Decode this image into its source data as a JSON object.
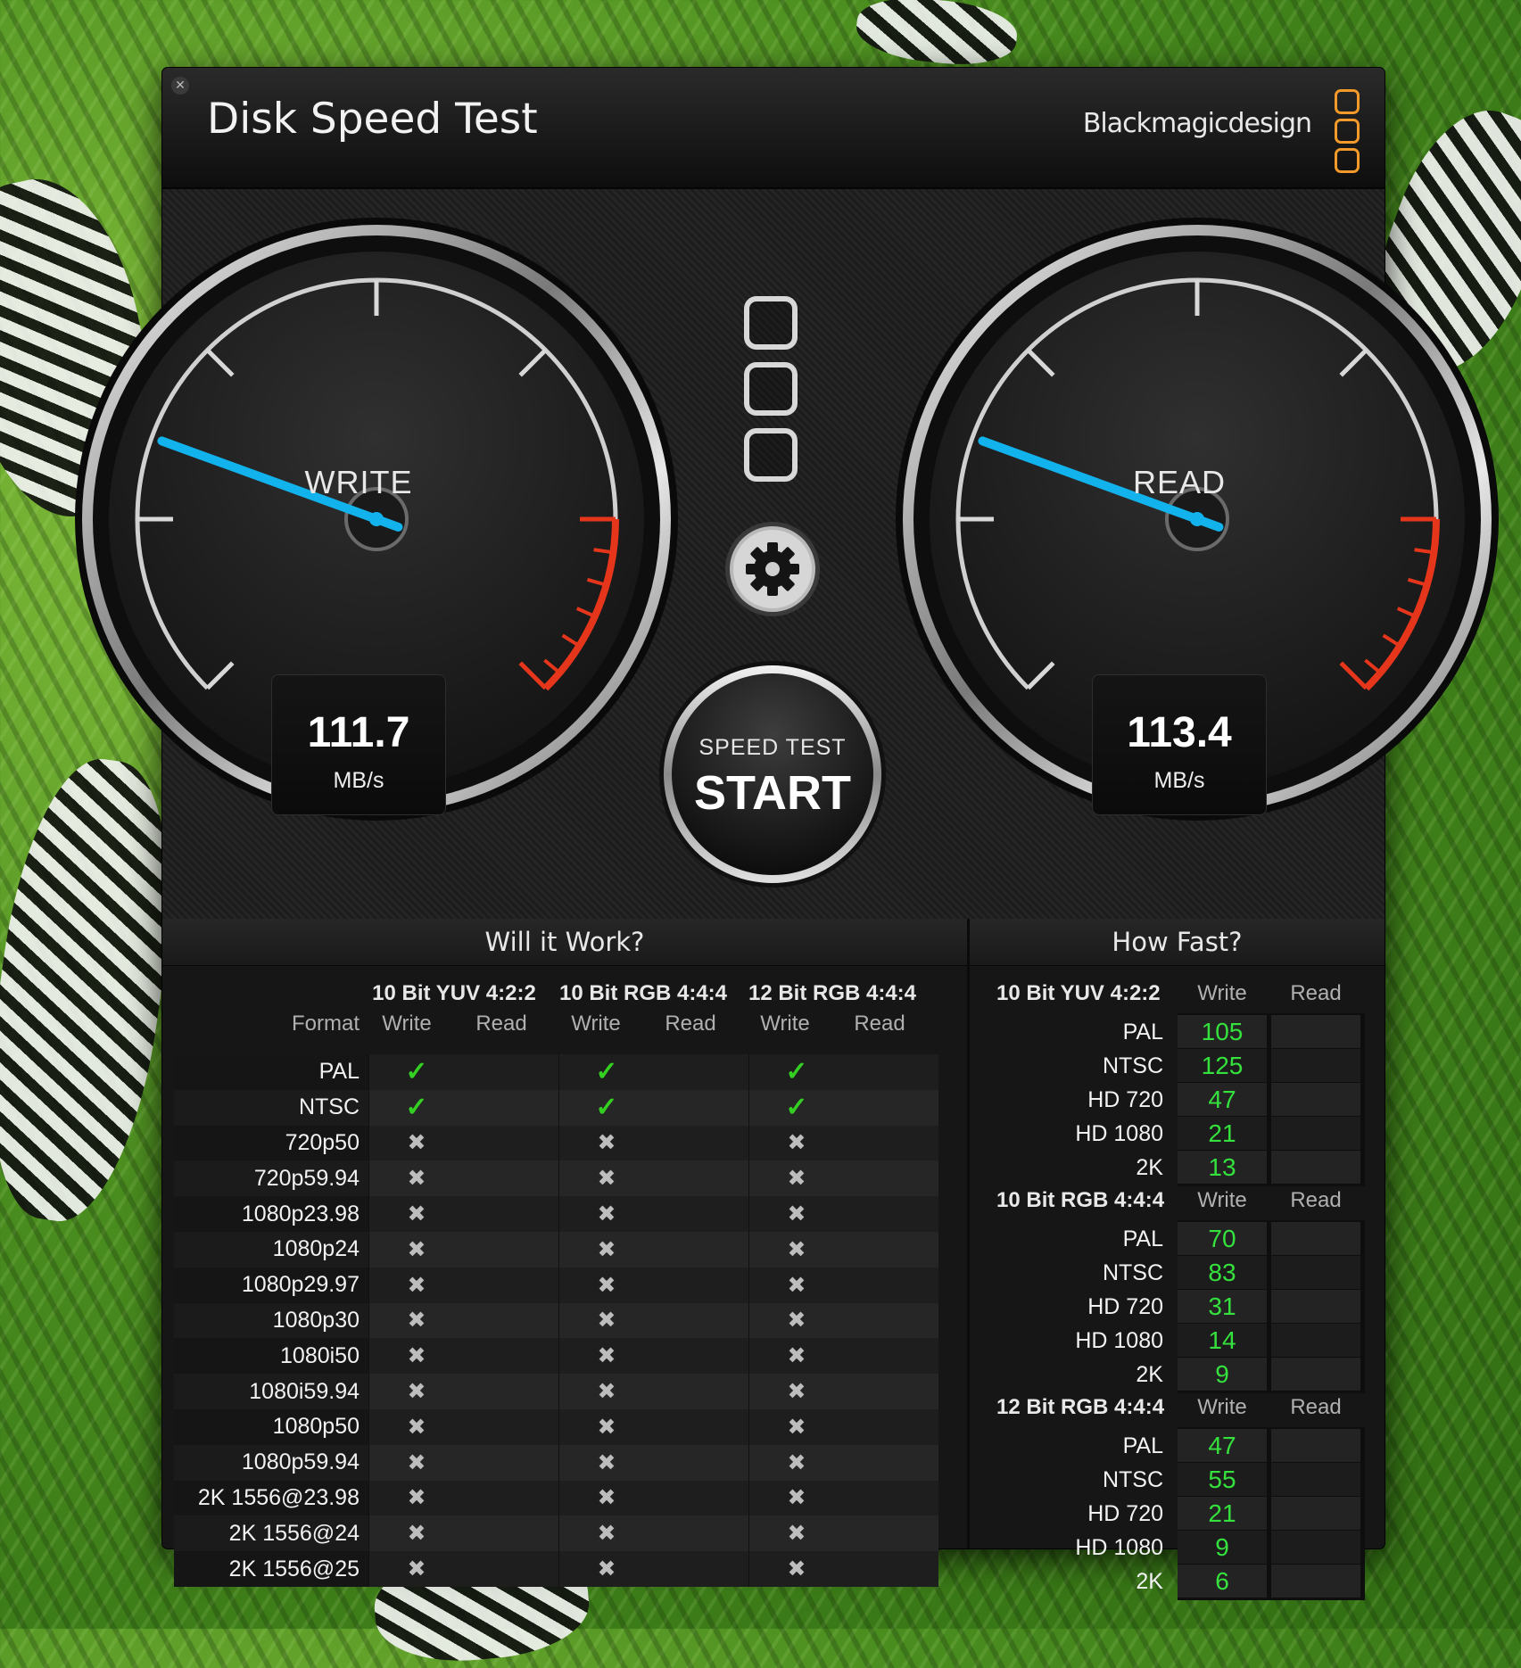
{
  "window": {
    "title": "Disk Speed Test",
    "brand": "Blackmagicdesign",
    "close_icon": "close-icon"
  },
  "gauges": {
    "write": {
      "label": "WRITE",
      "value": "111.7",
      "unit": "MB/s"
    },
    "read": {
      "label": "READ",
      "value": "113.4",
      "unit": "MB/s"
    },
    "needle_color": "#12b3ec",
    "redline_color": "#e5361c"
  },
  "start_button": {
    "top": "SPEED TEST",
    "label": "START"
  },
  "will_it_work": {
    "title": "Will it Work?",
    "format_header": "Format",
    "columns": [
      {
        "name": "10 Bit YUV 4:2:2",
        "write": "Write",
        "read": "Read"
      },
      {
        "name": "10 Bit RGB 4:4:4",
        "write": "Write",
        "read": "Read"
      },
      {
        "name": "12 Bit RGB 4:4:4",
        "write": "Write",
        "read": "Read"
      }
    ],
    "rows": [
      {
        "format": "PAL",
        "ok": true
      },
      {
        "format": "NTSC",
        "ok": true
      },
      {
        "format": "720p50",
        "ok": false
      },
      {
        "format": "720p59.94",
        "ok": false
      },
      {
        "format": "1080p23.98",
        "ok": false
      },
      {
        "format": "1080p24",
        "ok": false
      },
      {
        "format": "1080p29.97",
        "ok": false
      },
      {
        "format": "1080p30",
        "ok": false
      },
      {
        "format": "1080i50",
        "ok": false
      },
      {
        "format": "1080i59.94",
        "ok": false
      },
      {
        "format": "1080p50",
        "ok": false
      },
      {
        "format": "1080p59.94",
        "ok": false
      },
      {
        "format": "2K 1556@23.98",
        "ok": false
      },
      {
        "format": "2K 1556@24",
        "ok": false
      },
      {
        "format": "2K 1556@25",
        "ok": false
      }
    ]
  },
  "how_fast": {
    "title": "How Fast?",
    "groups": [
      {
        "name": "10 Bit YUV 4:2:2",
        "write": "Write",
        "read": "Read",
        "rows": [
          {
            "label": "PAL",
            "write": "105"
          },
          {
            "label": "NTSC",
            "write": "125"
          },
          {
            "label": "HD 720",
            "write": "47"
          },
          {
            "label": "HD 1080",
            "write": "21"
          },
          {
            "label": "2K",
            "write": "13"
          }
        ]
      },
      {
        "name": "10 Bit RGB 4:4:4",
        "write": "Write",
        "read": "Read",
        "rows": [
          {
            "label": "PAL",
            "write": "70"
          },
          {
            "label": "NTSC",
            "write": "83"
          },
          {
            "label": "HD 720",
            "write": "31"
          },
          {
            "label": "HD 1080",
            "write": "14"
          },
          {
            "label": "2K",
            "write": "9"
          }
        ]
      },
      {
        "name": "12 Bit RGB 4:4:4",
        "write": "Write",
        "read": "Read",
        "rows": [
          {
            "label": "PAL",
            "write": "47"
          },
          {
            "label": "NTSC",
            "write": "55"
          },
          {
            "label": "HD 720",
            "write": "21"
          },
          {
            "label": "HD 1080",
            "write": "9"
          },
          {
            "label": "2K",
            "write": "6"
          }
        ]
      }
    ]
  }
}
